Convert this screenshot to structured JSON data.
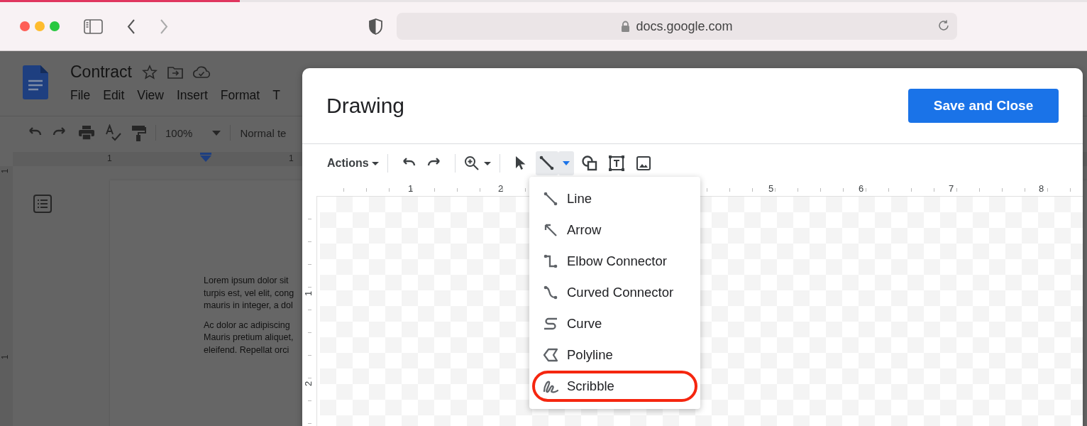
{
  "browser": {
    "url": "docs.google.com"
  },
  "docs": {
    "title": "Contract",
    "menu": [
      "File",
      "Edit",
      "View",
      "Insert",
      "Format",
      "T"
    ],
    "zoom": "100%",
    "style": "Normal te",
    "ruler_labels": [
      "1",
      "1"
    ],
    "vruler_labels": [
      "1",
      "1"
    ],
    "paragraphs": [
      [
        "Lorem ipsum dolor sit",
        "turpis est, vel elit, cong",
        "mauris in integer, a dol"
      ],
      [
        "Ac dolor ac adipiscing",
        "Mauris pretium aliquet,",
        "eleifend. Repellat orci"
      ]
    ]
  },
  "drawing": {
    "title": "Drawing",
    "save_button": "Save and Close",
    "actions": "Actions",
    "tools": [
      {
        "kind": "select",
        "selected": false
      },
      {
        "kind": "line",
        "selected": true
      },
      {
        "kind": "shape",
        "selected": false
      },
      {
        "kind": "textbox",
        "selected": false
      },
      {
        "kind": "image",
        "selected": false
      }
    ],
    "ruler_labels": [
      "1",
      "2",
      "5",
      "6",
      "7",
      "8"
    ],
    "vruler_labels": [
      "1",
      "2"
    ],
    "line_menu": [
      {
        "label": "Line",
        "kind": "line",
        "circled": false
      },
      {
        "label": "Arrow",
        "kind": "arrow",
        "circled": false
      },
      {
        "label": "Elbow Connector",
        "kind": "elbow",
        "circled": false
      },
      {
        "label": "Curved Connector",
        "kind": "curved",
        "circled": false
      },
      {
        "label": "Curve",
        "kind": "curve",
        "circled": false
      },
      {
        "label": "Polyline",
        "kind": "polyline",
        "circled": false
      },
      {
        "label": "Scribble",
        "kind": "scribble",
        "circled": true
      }
    ]
  }
}
